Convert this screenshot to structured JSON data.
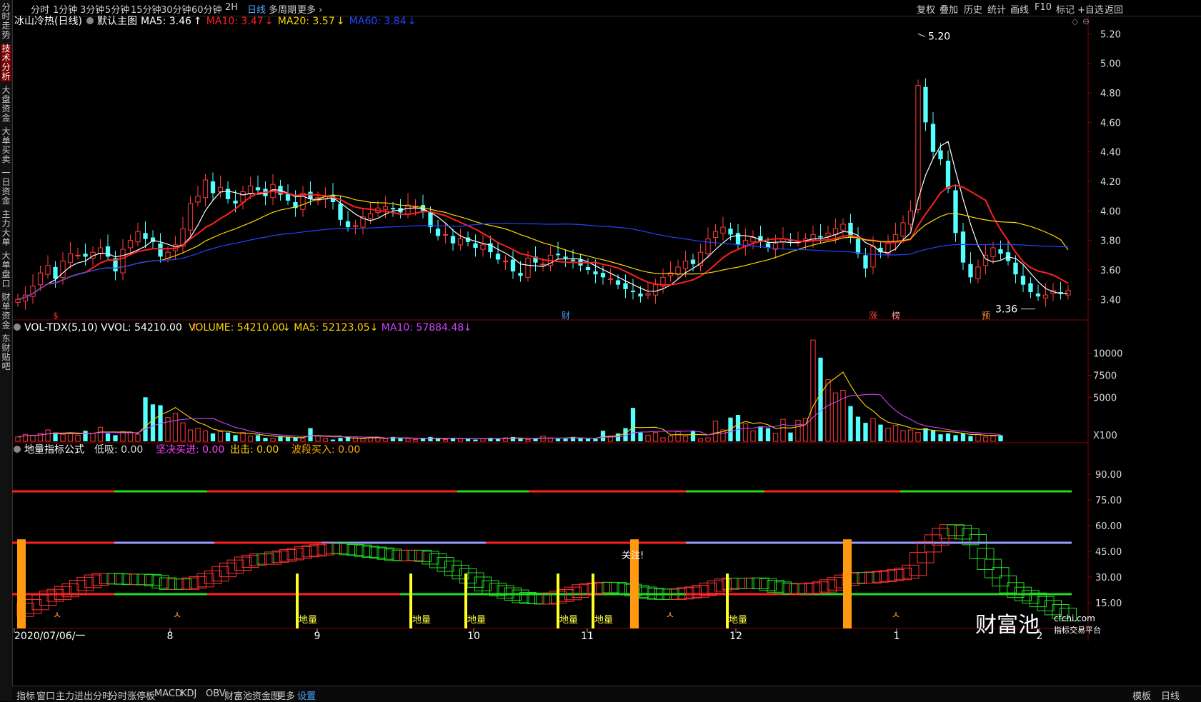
{
  "toolbar": {
    "periods": [
      "分时",
      "1分钟",
      "3分钟",
      "5分钟",
      "15分钟",
      "30分钟",
      "60分钟",
      "2H",
      "日线",
      "多周期",
      "更多"
    ],
    "active_period": "日线",
    "right_items": [
      "复权",
      "叠加",
      "历史",
      "统计",
      "画线",
      "F10",
      "标记",
      "+自选",
      "返回"
    ]
  },
  "sidebar": {
    "items": [
      "分时走势",
      "技术分析",
      "大盘资金",
      "大单买卖",
      "一日资金",
      "主力大单",
      "大单盘口",
      "财单资金",
      "东财贴吧"
    ],
    "active": "技术分析"
  },
  "bottom_tabs": [
    "指标",
    "窗口",
    "主力进出分时",
    "分时涨停板",
    "MACD",
    "KDJ",
    "OBV",
    "财富池资金图",
    "更多",
    "设置"
  ],
  "bottom_active": "设置",
  "bottom_right": [
    "模板",
    "日线"
  ],
  "watermark": {
    "brand": "财富池",
    "domain": "cfchi.com",
    "tagline": "指标交易平台"
  },
  "price_panel": {
    "title": "冰山冷热(日线)",
    "template": "默认主图",
    "ma_labels": [
      {
        "text": "MA5: 3.46",
        "arrow": "↑",
        "color": "#ffffff"
      },
      {
        "text": "MA10: 3.47",
        "arrow": "↓",
        "color": "#ff2020"
      },
      {
        "text": "MA20: 3.57",
        "arrow": "↓",
        "color": "#ffd700"
      },
      {
        "text": "MA60: 3.84",
        "arrow": "↓",
        "color": "#2244ff"
      }
    ],
    "high_label": "5.20",
    "low_label": "3.36",
    "markers": [
      {
        "text": "$",
        "color": "#ff3333"
      },
      {
        "text": "财",
        "color": "#4499ff"
      },
      {
        "text": "涨",
        "color": "#ff4444"
      },
      {
        "text": "榜",
        "color": "#ff9999"
      },
      {
        "text": "预",
        "color": "#ff9933"
      }
    ],
    "y_ticks": [
      "5.20",
      "5.00",
      "4.80",
      "4.60",
      "4.40",
      "4.20",
      "4.00",
      "3.80",
      "3.60",
      "3.40"
    ],
    "y_range": [
      3.3,
      5.26
    ]
  },
  "volume_panel": {
    "title": "VOL-TDX(5,10) VVOL: 54210.00",
    "title_arrow": "↑",
    "labels": [
      {
        "text": "VOLUME: 54210.00",
        "arrow": "↓",
        "color": "#ffd700"
      },
      {
        "text": "MA5: 52123.05",
        "arrow": "↓",
        "color": "#ffd700"
      },
      {
        "text": "MA10: 57884.48",
        "arrow": "↓",
        "color": "#cc44ff"
      }
    ],
    "y_ticks": [
      "10000",
      "7500",
      "5000"
    ],
    "unit": "X100"
  },
  "indicator_panel": {
    "title": "地量指标公式",
    "labels": [
      {
        "text": "低吸: 0.00",
        "color": "#dddddd"
      },
      {
        "text": "坚决买进: 0.00",
        "color": "#ff44ff"
      },
      {
        "text": "出击: 0.00",
        "color": "#ffd700"
      },
      {
        "text": "波段买入: 0.00",
        "color": "#ffaa00"
      }
    ],
    "y_ticks": [
      "90.00",
      "75.00",
      "60.00",
      "45.00",
      "30.00",
      "15.00"
    ],
    "signal_label": "地量",
    "focus_label": "关注!"
  },
  "x_axis": {
    "labels": [
      "2020/07/06/一",
      "8",
      "9",
      "10",
      "11",
      "12",
      "1",
      "2"
    ]
  },
  "chart_data": {
    "type": "candlestick",
    "close": [
      3.4,
      3.43,
      3.49,
      3.58,
      3.63,
      3.54,
      3.66,
      3.71,
      3.7,
      3.69,
      3.72,
      3.75,
      3.69,
      3.59,
      3.74,
      3.8,
      3.86,
      3.81,
      3.79,
      3.69,
      3.72,
      3.77,
      3.88,
      4.05,
      4.1,
      4.21,
      4.12,
      4.16,
      4.08,
      4.05,
      4.13,
      4.17,
      4.14,
      4.1,
      4.18,
      4.11,
      4.07,
      4.02,
      4.12,
      4.08,
      4.09,
      4.1,
      4.06,
      3.94,
      3.89,
      3.9,
      3.96,
      3.98,
      4.02,
      4.03,
      4.01,
      3.99,
      4.04,
      4.03,
      4.0,
      3.89,
      3.83,
      3.84,
      3.78,
      3.81,
      3.79,
      3.75,
      3.77,
      3.72,
      3.67,
      3.66,
      3.59,
      3.56,
      3.68,
      3.65,
      3.64,
      3.7,
      3.7,
      3.68,
      3.66,
      3.63,
      3.6,
      3.57,
      3.55,
      3.54,
      3.5,
      3.47,
      3.45,
      3.42,
      3.44,
      3.5,
      3.55,
      3.58,
      3.62,
      3.66,
      3.64,
      3.72,
      3.81,
      3.86,
      3.89,
      3.84,
      3.77,
      3.8,
      3.82,
      3.79,
      3.75,
      3.78,
      3.81,
      3.8,
      3.79,
      3.81,
      3.84,
      3.82,
      3.85,
      3.88,
      3.91,
      3.82,
      3.71,
      3.61,
      3.76,
      3.72,
      3.78,
      3.84,
      3.92,
      4.0,
      4.85,
      4.6,
      4.4,
      4.35,
      4.15,
      3.85,
      3.65,
      3.55,
      3.62,
      3.7,
      3.75,
      3.71,
      3.66,
      3.57,
      3.5,
      3.45,
      3.42,
      3.43,
      3.46,
      3.44,
      3.46
    ],
    "volume": [
      500,
      800,
      700,
      900,
      1300,
      1000,
      800,
      900,
      700,
      1200,
      900,
      1600,
      900,
      700,
      1100,
      1000,
      800,
      5000,
      4200,
      4100,
      2700,
      3200,
      2100,
      1300,
      1500,
      1200,
      900,
      1100,
      1000,
      700,
      1000,
      600,
      700,
      400,
      300,
      600,
      500,
      400,
      300,
      1500,
      600,
      300,
      200,
      400,
      500,
      400,
      300,
      400,
      400,
      300,
      500,
      400,
      300,
      200,
      300,
      500,
      300,
      200,
      400,
      300,
      300,
      200,
      300,
      400,
      300,
      400,
      500,
      300,
      200,
      300,
      600,
      400,
      300,
      300,
      500,
      400,
      300,
      300,
      1200,
      600,
      900,
      1500,
      3800,
      1000,
      700,
      1000,
      400,
      600,
      1100,
      600,
      1200,
      300,
      400,
      2300,
      1300,
      2700,
      3000,
      2000,
      1200,
      1700,
      1500,
      900,
      2500,
      1000,
      2400,
      2600,
      11500,
      9500,
      7000,
      5500,
      5800,
      4000,
      2800,
      2100,
      2600,
      1900,
      1500,
      1800,
      1200,
      1300,
      1000,
      1500,
      1300,
      800,
      900,
      700,
      900,
      600,
      800,
      500,
      600,
      700
    ],
    "x_labels": [
      "2020/07/06/一",
      "8",
      "9",
      "10",
      "11",
      "12",
      "1",
      "2"
    ],
    "ma_periods": [
      5,
      10,
      20,
      60
    ],
    "ylim": [
      3.3,
      5.26
    ]
  }
}
